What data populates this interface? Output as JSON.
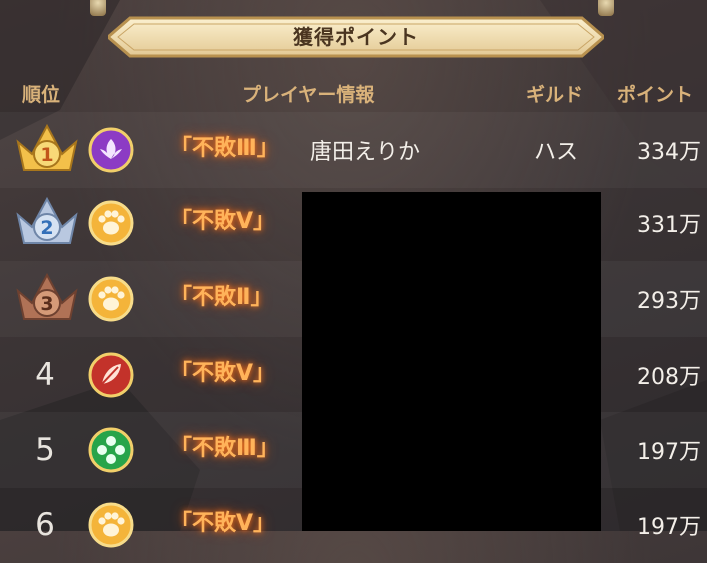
{
  "panel": {
    "title": "獲得ポイント"
  },
  "columns": {
    "rank": "順位",
    "player": "プレイヤー情報",
    "guild": "ギルド",
    "points": "ポイント"
  },
  "colors": {
    "header_text": "#d9b27a",
    "badge_glow": "#ff7a1e",
    "gold": "#f3c04a",
    "silver": "#9fb4d6",
    "bronze": "#b07256"
  },
  "rows": [
    {
      "rank": "1",
      "crown": "gold-crown-icon",
      "emblem": "purple-lotus-emblem",
      "badge": "「不敗Ⅲ」",
      "name": "唐田えりか",
      "guild": "ハス",
      "points": "334万"
    },
    {
      "rank": "2",
      "crown": "silver-crown-icon",
      "emblem": "paw-emblem",
      "badge": "「不敗Ⅴ」",
      "name": "",
      "guild": "",
      "points": "331万"
    },
    {
      "rank": "3",
      "crown": "bronze-crown-icon",
      "emblem": "paw-emblem",
      "badge": "「不敗Ⅱ」",
      "name": "",
      "guild": "",
      "points": "293万"
    },
    {
      "rank": "4",
      "crown": "",
      "emblem": "red-leaf-emblem",
      "badge": "「不敗Ⅴ」",
      "name": "",
      "guild": "",
      "points": "208万"
    },
    {
      "rank": "5",
      "crown": "",
      "emblem": "green-flower-emblem",
      "badge": "「不敗Ⅲ」",
      "name": "",
      "guild": "",
      "points": "197万"
    },
    {
      "rank": "6",
      "crown": "",
      "emblem": "paw-emblem",
      "badge": "「不敗Ⅴ」",
      "name": "",
      "guild": "",
      "points": "197万"
    }
  ]
}
